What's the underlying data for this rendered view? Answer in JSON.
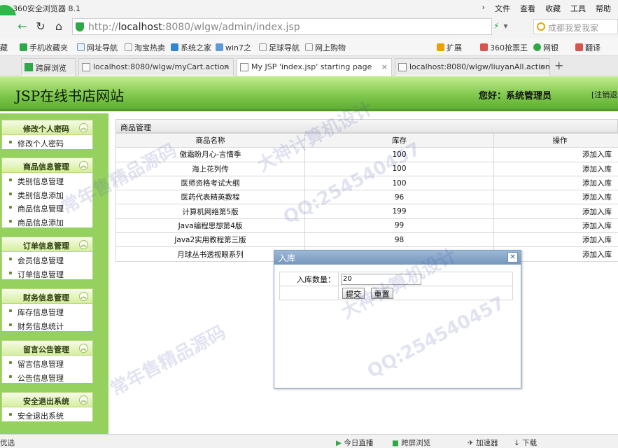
{
  "browser": {
    "app_title": "360安全浏览器 8.1",
    "menus": [
      "文件",
      "查看",
      "收藏",
      "工具",
      "帮助"
    ],
    "url_prefix": "http://",
    "url_host": "localhost",
    "url_rest": ":8080/wlgw/admin/index.jsp",
    "search_placeholder": "成都我爱我家",
    "bookmarks": [
      "藏",
      "手机收藏夹",
      "网址导航",
      "淘宝热卖",
      "系统之家",
      "win7之",
      "足球导航",
      "网上购物",
      "扩展",
      "360抢票王",
      "网银",
      "翻译"
    ],
    "tabs": [
      {
        "label": "跨屏浏览",
        "active": false
      },
      {
        "label": "localhost:8080/wlgw/myCart.action",
        "active": false
      },
      {
        "label": "My JSP 'index.jsp' starting page",
        "active": true
      },
      {
        "label": "localhost:8080/wlgw/liuyanAll.action",
        "active": false
      }
    ],
    "status_items": [
      "优选",
      "今日直播",
      "跨屏浏览",
      "加速器",
      "下载"
    ]
  },
  "header": {
    "site_title": "JSP在线书店网站",
    "greeting": "您好：系统管理员",
    "logout": "[注销退出]"
  },
  "sidebar": {
    "groups": [
      {
        "title": "修改个人密码",
        "items": [
          "修改个人密码"
        ]
      },
      {
        "title": "商品信息管理",
        "items": [
          "类别信息管理",
          "类别信息添加",
          "商品信息管理",
          "商品信息添加"
        ]
      },
      {
        "title": "订单信息管理",
        "items": [
          "会员信息管理",
          "订单信息管理"
        ]
      },
      {
        "title": "财务信息管理",
        "items": [
          "库存信息管理",
          "财务信息统计"
        ]
      },
      {
        "title": "留言公告管理",
        "items": [
          "留言信息管理",
          "公告信息管理"
        ]
      },
      {
        "title": "安全退出系统",
        "items": [
          "安全退出系统"
        ]
      }
    ]
  },
  "main": {
    "panel_title": "商品管理",
    "columns": [
      "商品名称",
      "库存",
      "操作"
    ],
    "rows": [
      {
        "name": "傲霜盼月心-言情季",
        "stock": "100",
        "action": "添加入库"
      },
      {
        "name": "海上花列传",
        "stock": "100",
        "action": "添加入库"
      },
      {
        "name": "医师资格考试大纲",
        "stock": "100",
        "action": "添加入库"
      },
      {
        "name": "医药代表精英教程",
        "stock": "96",
        "action": "添加入库"
      },
      {
        "name": "计算机网络第5版",
        "stock": "199",
        "action": "添加入库"
      },
      {
        "name": "Java编程思想第4版",
        "stock": "99",
        "action": "添加入库"
      },
      {
        "name": "Java2实用教程第三版",
        "stock": "98",
        "action": "添加入库"
      },
      {
        "name": "月球丛书透视眼系列",
        "stock": "",
        "action": "添加入库"
      }
    ]
  },
  "dialog": {
    "title": "入库",
    "label": "入库数量：",
    "value": "20",
    "submit": "提交",
    "reset": "重置"
  },
  "watermarks": [
    "常年售精品源码",
    "大神计算机设计",
    "QQ:254540457"
  ]
}
